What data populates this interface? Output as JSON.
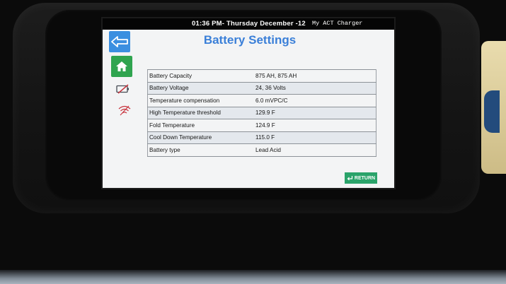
{
  "status_bar": {
    "datetime": "01:36 PM- Thursday December -12",
    "device_name": "My ACT Charger"
  },
  "page": {
    "title": "Battery Settings"
  },
  "sidebar": {
    "back_icon": "arrow-left-icon",
    "home_icon": "home-icon",
    "battery_icon": "battery-disabled-icon",
    "wifi_icon": "wifi-disabled-icon"
  },
  "settings": [
    {
      "label": "Battery Capacity",
      "value": "875 AH, 875 AH"
    },
    {
      "label": "Battery Voltage",
      "value": "24, 36 Volts"
    },
    {
      "label": "Temperature compensation",
      "value": "6.0 mVPC/C"
    },
    {
      "label": "High Temperature threshold",
      "value": "129.9 F"
    },
    {
      "label": "Fold Temperature",
      "value": "124.9 F"
    },
    {
      "label": "Cool Down Temperature",
      "value": "115.0 F"
    },
    {
      "label": "Battery type",
      "value": "Lead Acid"
    }
  ],
  "footer": {
    "return_label": "RETURN"
  },
  "colors": {
    "title_blue": "#3a7fd8",
    "back_button": "#3b8fe0",
    "home_button": "#2fa44f",
    "return_button": "#2aa36a",
    "disabled_red": "#c8323c"
  }
}
